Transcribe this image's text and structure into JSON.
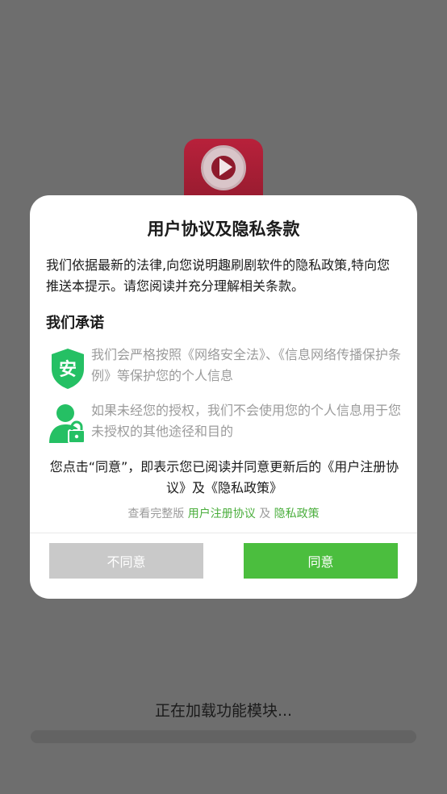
{
  "dialog": {
    "title": "用户协议及隐私条款",
    "intro": "我们依据最新的法律,向您说明趣刷剧软件的隐私政策,特向您推送本提示。请您阅读并充分理解相关条款。",
    "promise_heading": "我们承诺",
    "promise_items": [
      {
        "icon": "shield-icon",
        "icon_char": "安",
        "text": "我们会严格按照《网络安全法》、《信息网络传播保护条例》等保护您的个人信息"
      },
      {
        "icon": "user-lock-icon",
        "text": "如果未经您的授权，我们不会使用您的个人信息用于您未授权的其他途径和目的"
      }
    ],
    "confirm_text": "您点击“同意”，即表示您已阅读并同意更新后的《用户注册协议》及《隐私政策》",
    "links": {
      "prefix": "查看完整版 ",
      "user_agreement": "用户注册协议",
      "and": " 及 ",
      "privacy_policy": "隐私政策"
    },
    "disagree_label": "不同意",
    "agree_label": "同意"
  },
  "loading": {
    "text": "正在加载功能模块...",
    "progress": 0
  },
  "colors": {
    "accent": "#4bbe3e",
    "link": "#4aae3c",
    "disabled": "#c9c9c9",
    "overlay": "#6e6e6e",
    "app_icon": "#b8213b"
  }
}
